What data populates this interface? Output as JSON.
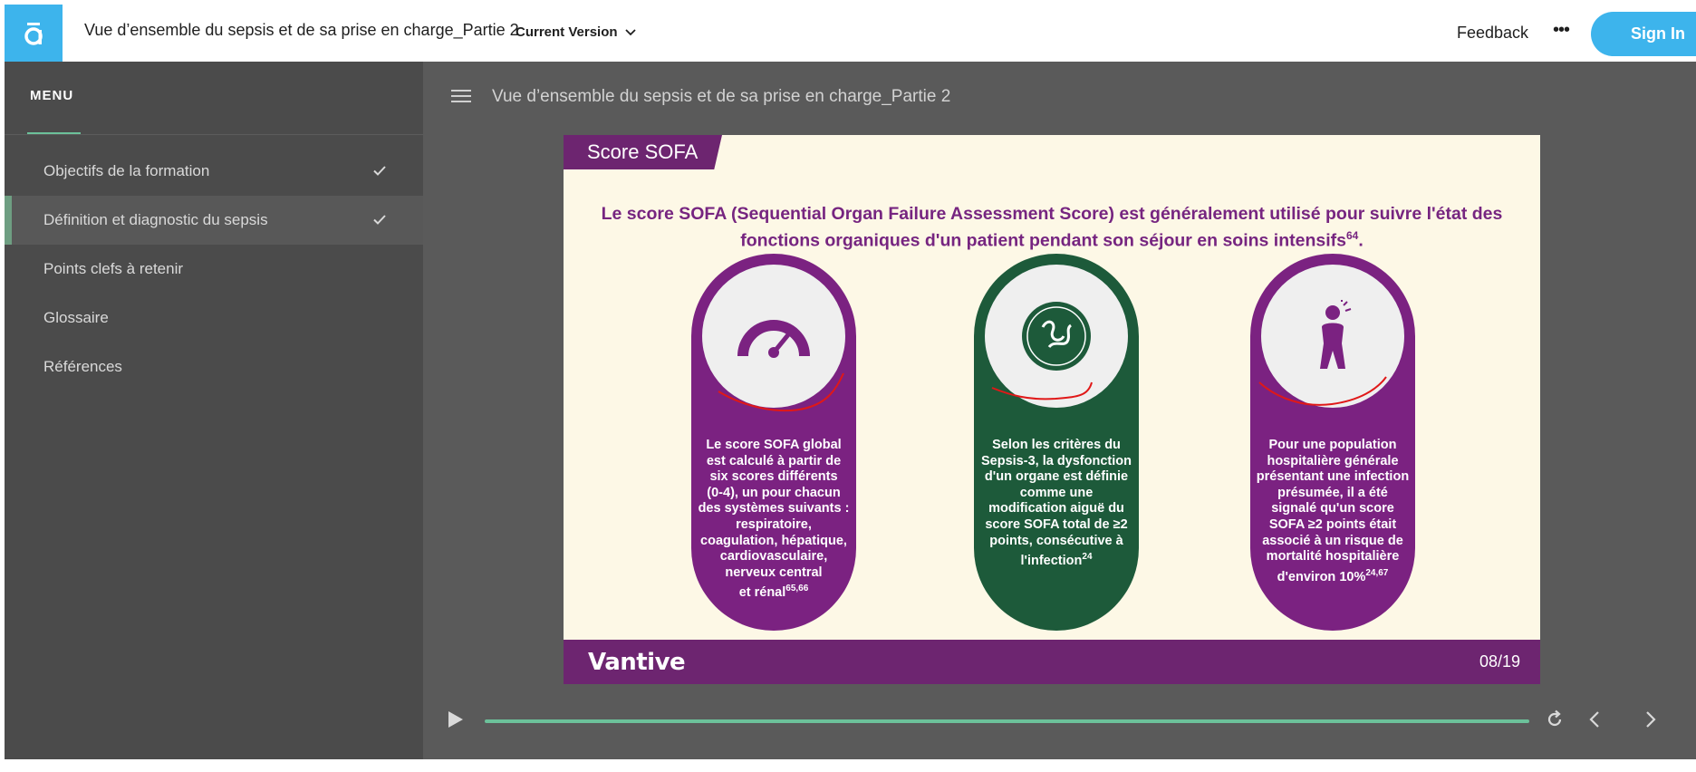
{
  "header": {
    "logo_icon": "app-logo-icon",
    "course_title": "Vue d’ensemble du sepsis et de sa prise en charge_Partie 2",
    "version_label": "Current Version",
    "feedback_label": "Feedback",
    "more_label": "•••",
    "signin_label": "Sign In"
  },
  "sidebar": {
    "menu_heading": "MENU",
    "items": [
      {
        "label": "Objectifs de la formation",
        "completed": true
      },
      {
        "label": "Définition et diagnostic du sepsis",
        "completed": true
      },
      {
        "label": "Points clefs à retenir",
        "completed": false
      },
      {
        "label": "Glossaire",
        "completed": false
      },
      {
        "label": "Références",
        "completed": false
      }
    ]
  },
  "main": {
    "lesson_title": "Vue d’ensemble du sepsis et de sa prise en charge_Partie 2",
    "slide": {
      "tag": "Score SOFA",
      "headline_part1": "Le score SOFA (Sequential Organ Failure Assessment Score) est généralement utilisé pour suivre l'état des fonctions organiques d'un patient pendant son séjour en soins intensifs",
      "headline_ref": "64",
      "headline_end": ".",
      "cards": [
        {
          "icon": "speedometer-icon",
          "lines": [
            "Le score SOFA global est calculé à partir de six scores différents",
            "(0-4), un pour chacun des systèmes suivants : respiratoire, coagulation, hépatique, cardiovasculaire, nerveux central",
            "et rénal"
          ],
          "ref": "65,66"
        },
        {
          "icon": "organ-icon",
          "lines": [
            "Selon les critères du Sepsis-3, la dysfonction d'un organe est définie comme une modification aiguë du score SOFA total de ≥2 points,",
            "consécutive à l'infection"
          ],
          "ref": "24"
        },
        {
          "icon": "sick-person-icon",
          "lines": [
            "Pour une population hospitalière générale présentant une infection",
            "présumée, il a été signalé qu'un score SOFA ≥2 points était associé à un risque de mortalité hospitalière d'environ 10%"
          ],
          "ref": "24,67"
        }
      ],
      "brand": "Vantive",
      "slide_number": "08/19"
    },
    "player": {
      "progress": 1.0,
      "accent_color": "#6cc19a"
    }
  },
  "colors": {
    "brand_blue": "#3db4ec",
    "sidebar_bg": "#4b4b4b",
    "main_bg": "#5a5a5a",
    "slide_purple": "#6d2570",
    "slide_green": "#1d5a3a"
  }
}
